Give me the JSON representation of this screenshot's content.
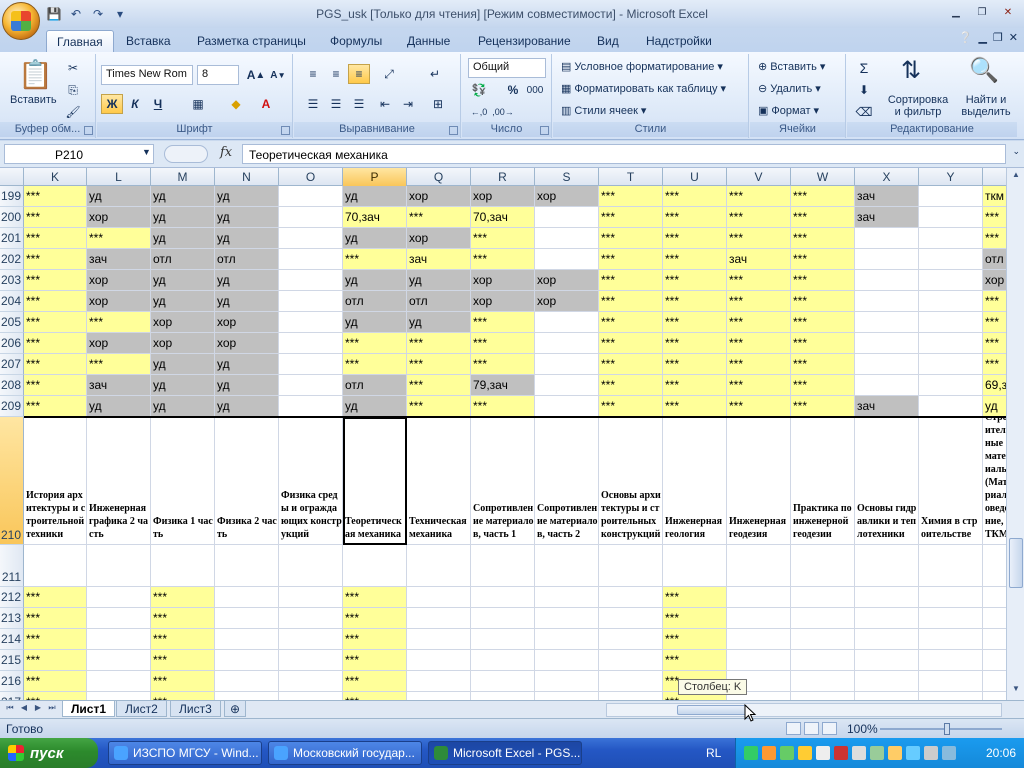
{
  "app": {
    "window_title": "PGS_usk  [Только для чтения]  [Режим совместимости] - Microsoft Excel"
  },
  "tabs": [
    "Главная",
    "Вставка",
    "Разметка страницы",
    "Формулы",
    "Данные",
    "Рецензирование",
    "Вид",
    "Надстройки"
  ],
  "ribbon": {
    "clipboard": {
      "paste": "Вставить",
      "label": "Буфер обм..."
    },
    "font": {
      "name": "Times New Rom",
      "size": "8",
      "bold": "Ж",
      "italic": "К",
      "underline": "Ч",
      "label": "Шрифт"
    },
    "alignment": {
      "label": "Выравнивание"
    },
    "number": {
      "format": "Общий",
      "percent": "%",
      "thousands": "000",
      "label": "Число"
    },
    "styles": {
      "conditional": "Условное форматирование",
      "table": "Форматировать как таблицу",
      "cell_styles": "Стили ячеек",
      "label": "Стили"
    },
    "cells": {
      "insert": "Вставить",
      "delete": "Удалить",
      "format": "Формат",
      "label": "Ячейки"
    },
    "editing": {
      "sort": "Сортировка и фильтр",
      "find": "Найти и выделить",
      "label": "Редактирование"
    }
  },
  "formula_bar": {
    "name_box": "P210",
    "fx": "fx",
    "value": "Теоретическая механика"
  },
  "columns": [
    "K",
    "L",
    "M",
    "N",
    "O",
    "P",
    "Q",
    "R",
    "S",
    "T",
    "U",
    "V",
    "W",
    "X",
    "Y"
  ],
  "rows": [
    {
      "n": "199",
      "cells": [
        "***",
        "уд",
        "уд",
        "уд",
        "",
        "уд",
        "хор",
        "хор",
        "хор",
        "***",
        "***",
        "***",
        "***",
        "зач",
        "",
        "ткм"
      ],
      "fill": [
        "y",
        "g",
        "g",
        "g",
        "",
        "g",
        "g",
        "g",
        "g",
        "y",
        "y",
        "y",
        "y",
        "g",
        "",
        "y"
      ]
    },
    {
      "n": "200",
      "cells": [
        "***",
        "хор",
        "уд",
        "уд",
        "",
        "70,зач",
        "***",
        "70,зач",
        "",
        "***",
        "***",
        "***",
        "***",
        "зач",
        "",
        "***"
      ],
      "fill": [
        "y",
        "g",
        "g",
        "g",
        "",
        "y",
        "y",
        "y",
        "",
        "y",
        "y",
        "y",
        "y",
        "g",
        "",
        "y"
      ]
    },
    {
      "n": "201",
      "cells": [
        "***",
        "***",
        "уд",
        "уд",
        "",
        "уд",
        "хор",
        "***",
        "",
        "***",
        "***",
        "***",
        "***",
        "",
        "",
        "***"
      ],
      "fill": [
        "y",
        "y",
        "g",
        "g",
        "",
        "g",
        "g",
        "y",
        "",
        "y",
        "y",
        "y",
        "y",
        "",
        "",
        "y"
      ]
    },
    {
      "n": "202",
      "cells": [
        "***",
        "зач",
        "отл",
        "отл",
        "",
        "***",
        "зач",
        "***",
        "",
        "***",
        "***",
        "зач",
        "***",
        "",
        "",
        "отл"
      ],
      "fill": [
        "y",
        "g",
        "g",
        "g",
        "",
        "y",
        "y",
        "y",
        "",
        "y",
        "y",
        "y",
        "y",
        "",
        "",
        "g"
      ]
    },
    {
      "n": "203",
      "cells": [
        "***",
        "хор",
        "уд",
        "уд",
        "",
        "уд",
        "уд",
        "хор",
        "хор",
        "***",
        "***",
        "***",
        "***",
        "",
        "",
        "хор"
      ],
      "fill": [
        "y",
        "g",
        "g",
        "g",
        "",
        "g",
        "g",
        "g",
        "g",
        "y",
        "y",
        "y",
        "y",
        "",
        "",
        "g"
      ]
    },
    {
      "n": "204",
      "cells": [
        "***",
        "хор",
        "уд",
        "уд",
        "",
        "отл",
        "отл",
        "хор",
        "хор",
        "***",
        "***",
        "***",
        "***",
        "",
        "",
        "***"
      ],
      "fill": [
        "y",
        "g",
        "g",
        "g",
        "",
        "g",
        "g",
        "g",
        "g",
        "y",
        "y",
        "y",
        "y",
        "",
        "",
        "y"
      ]
    },
    {
      "n": "205",
      "cells": [
        "***",
        "***",
        "хор",
        "хор",
        "",
        "уд",
        "уд",
        "***",
        "",
        "***",
        "***",
        "***",
        "***",
        "",
        "",
        "***"
      ],
      "fill": [
        "y",
        "y",
        "g",
        "g",
        "",
        "g",
        "g",
        "y",
        "",
        "y",
        "y",
        "y",
        "y",
        "",
        "",
        "y"
      ]
    },
    {
      "n": "206",
      "cells": [
        "***",
        "хор",
        "хор",
        "хор",
        "",
        "***",
        "***",
        "***",
        "",
        "***",
        "***",
        "***",
        "***",
        "",
        "",
        "***"
      ],
      "fill": [
        "y",
        "g",
        "g",
        "g",
        "",
        "y",
        "y",
        "y",
        "",
        "y",
        "y",
        "y",
        "y",
        "",
        "",
        "y"
      ]
    },
    {
      "n": "207",
      "cells": [
        "***",
        "***",
        "уд",
        "уд",
        "",
        "***",
        "***",
        "***",
        "",
        "***",
        "***",
        "***",
        "***",
        "",
        "",
        "***"
      ],
      "fill": [
        "y",
        "y",
        "g",
        "g",
        "",
        "y",
        "y",
        "y",
        "",
        "y",
        "y",
        "y",
        "y",
        "",
        "",
        "y"
      ]
    },
    {
      "n": "208",
      "cells": [
        "***",
        "зач",
        "уд",
        "уд",
        "",
        "отл",
        "***",
        "79,зач",
        "",
        "***",
        "***",
        "***",
        "***",
        "",
        "",
        "69,з"
      ],
      "fill": [
        "y",
        "g",
        "g",
        "g",
        "",
        "g",
        "y",
        "g",
        "",
        "y",
        "y",
        "y",
        "y",
        "",
        "",
        "y"
      ]
    },
    {
      "n": "209",
      "cells": [
        "***",
        "уд",
        "уд",
        "уд",
        "",
        "уд",
        "***",
        "***",
        "",
        "***",
        "***",
        "***",
        "***",
        "зач",
        "",
        "уд"
      ],
      "fill": [
        "y",
        "g",
        "g",
        "g",
        "",
        "g",
        "y",
        "y",
        "",
        "y",
        "y",
        "y",
        "y",
        "g",
        "",
        "y"
      ]
    }
  ],
  "header_row": {
    "n": "210",
    "cells": [
      "История архитектуры и строительной техники",
      "Инженерная графика 2 часть",
      "Физика 1 часть",
      "Физика 2 часть",
      "Физика среды и ограждающих конструкций",
      "Теоретическая механика",
      "Техническая механика",
      "Сопротивление материалов, часть 1",
      "Сопротивление материалов, часть 2",
      "Основы архитектуры и строительных конструкций",
      "Инженерная геология",
      "Инженерная геодезия",
      "Практика по инженерной геодезии",
      "Основы гидравлики и теплотехники",
      "Химия в строительстве",
      "Строительные материалы (Материаловедение, ТКМ)"
    ]
  },
  "lower_rows": [
    {
      "n": "211",
      "cells": [
        "",
        "",
        "",
        "",
        "",
        "",
        "",
        "",
        "",
        "",
        "",
        "",
        "",
        "",
        "",
        ""
      ]
    },
    {
      "n": "212",
      "cells": [
        "***",
        "",
        "***",
        "",
        "",
        "***",
        "",
        "",
        "",
        "",
        "***",
        "",
        "",
        "",
        "",
        ""
      ]
    },
    {
      "n": "213",
      "cells": [
        "***",
        "",
        "***",
        "",
        "",
        "***",
        "",
        "",
        "",
        "",
        "***",
        "",
        "",
        "",
        "",
        ""
      ]
    },
    {
      "n": "214",
      "cells": [
        "***",
        "",
        "***",
        "",
        "",
        "***",
        "",
        "",
        "",
        "",
        "***",
        "",
        "",
        "",
        "",
        ""
      ]
    },
    {
      "n": "215",
      "cells": [
        "***",
        "",
        "***",
        "",
        "",
        "***",
        "",
        "",
        "",
        "",
        "***",
        "",
        "",
        "",
        "",
        ""
      ]
    },
    {
      "n": "216",
      "cells": [
        "***",
        "",
        "***",
        "",
        "",
        "***",
        "",
        "",
        "",
        "",
        "***",
        "",
        "",
        "",
        "",
        ""
      ]
    },
    {
      "n": "217",
      "cells": [
        "***",
        "",
        "***",
        "",
        "",
        "***",
        "",
        "",
        "",
        "",
        "***",
        "",
        "",
        "",
        "",
        ""
      ]
    }
  ],
  "sheets": [
    "Лист1",
    "Лист2",
    "Лист3"
  ],
  "tooltip": "Столбец: K",
  "status": {
    "text": "Готово",
    "zoom": "100%"
  },
  "taskbar": {
    "start": "пуск",
    "tasks": [
      "ИЗСПО МГСУ - Wind...",
      "Московский государ...",
      "Microsoft Excel - PGS..."
    ],
    "lang": "RL",
    "clock": "20:06"
  },
  "colors": {
    "yellow": "#ffff99",
    "gray": "#c0c0c0",
    "selected_header": "#f9c65a"
  }
}
